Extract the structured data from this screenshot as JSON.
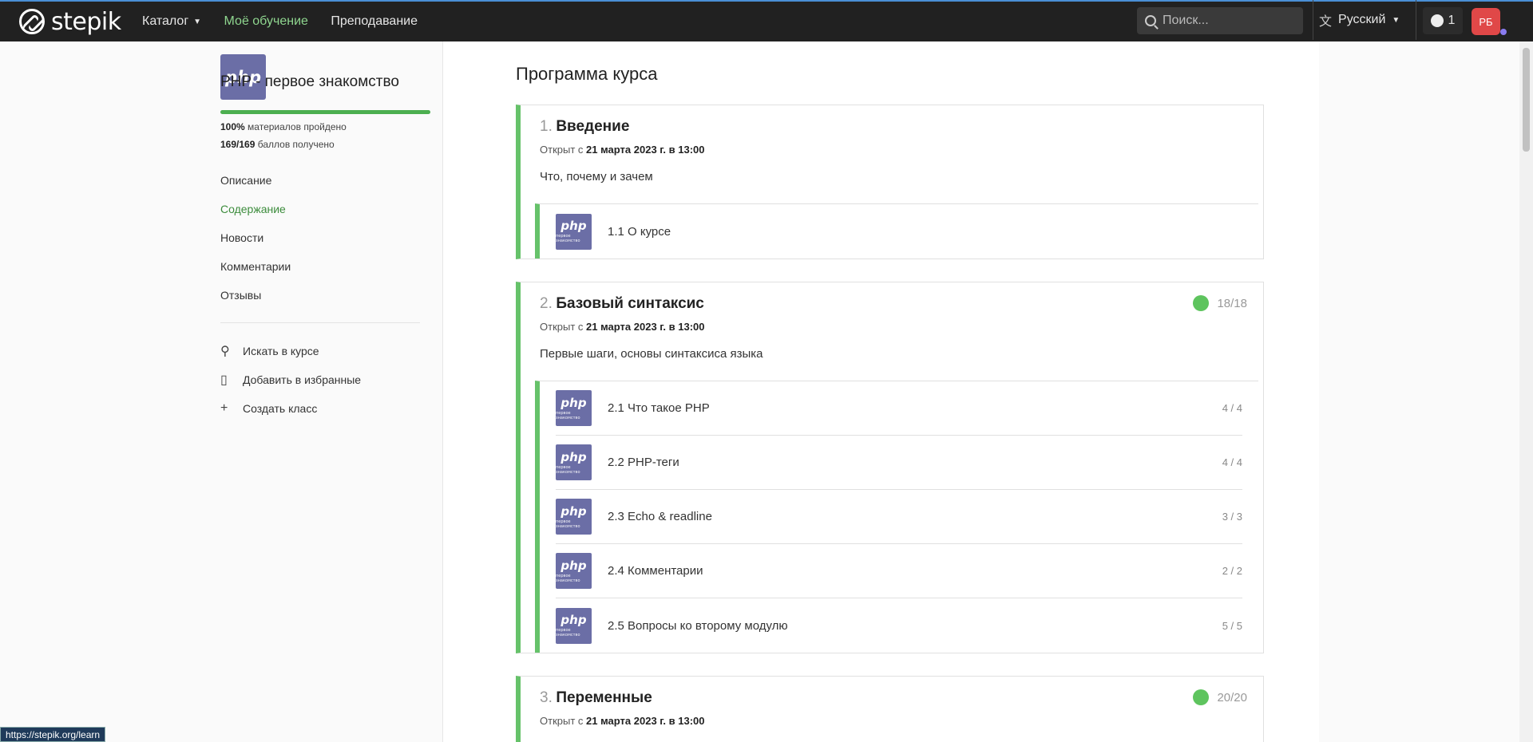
{
  "topbar": {
    "logo_text": "stepik",
    "nav": [
      {
        "label": "Каталог",
        "has_dropdown": true,
        "active": false
      },
      {
        "label": "Моё обучение",
        "active": true
      },
      {
        "label": "Преподавание",
        "active": false
      }
    ],
    "search_placeholder": "Поиск...",
    "language": "Русский",
    "notifications_count": "1",
    "avatar_initials": "РБ",
    "accent_colors": {
      "active_nav": "#8fd68f",
      "avatar": "#e04848"
    }
  },
  "sidebar": {
    "course_logo_text": "php",
    "course_title": "PHP - первое знакомство",
    "progress_fraction": 1.0,
    "materials_pct": "100%",
    "materials_text": "материалов пройдено",
    "score_value": "169/169",
    "score_text": "баллов получено",
    "menu": [
      {
        "label": "Описание",
        "active": false
      },
      {
        "label": "Содержание",
        "active": true
      },
      {
        "label": "Новости",
        "active": false
      },
      {
        "label": "Комментарии",
        "active": false
      },
      {
        "label": "Отзывы",
        "active": false
      }
    ],
    "actions": [
      {
        "icon": "search-icon",
        "label": "Искать в курсе"
      },
      {
        "icon": "bookmark-icon",
        "label": "Добавить в избранные"
      },
      {
        "icon": "plus-icon",
        "label": "Создать класс"
      }
    ]
  },
  "main": {
    "title": "Программа курса",
    "open_prefix": "Открыт с",
    "modules": [
      {
        "num": "1.",
        "name": "Введение",
        "open_date": "21 марта 2023 г. в 13:00",
        "description": "Что, почему и зачем",
        "score": null,
        "lessons": [
          {
            "title": "1.1 О курсе",
            "score": ""
          }
        ]
      },
      {
        "num": "2.",
        "name": "Базовый синтаксис",
        "open_date": "21 марта 2023 г. в 13:00",
        "description": "Первые шаги, основы синтаксиса языка",
        "score": "18/18",
        "lessons": [
          {
            "title": "2.1 Что такое PHP",
            "score": "4 / 4"
          },
          {
            "title": "2.2 PHP-теги",
            "score": "4 / 4"
          },
          {
            "title": "2.3 Echo & readline",
            "score": "3 / 3"
          },
          {
            "title": "2.4 Комментарии",
            "score": "2 / 2"
          },
          {
            "title": "2.5 Вопросы ко второму модулю",
            "score": "5 / 5"
          }
        ]
      },
      {
        "num": "3.",
        "name": "Переменные",
        "open_date": "21 марта 2023 г. в 13:00",
        "description": "",
        "score": "20/20",
        "lessons": []
      }
    ],
    "lesson_thumb_text": "php",
    "lesson_thumb_sub": "первое знакомство"
  },
  "statusbar_url": "https://stepik.org/learn"
}
